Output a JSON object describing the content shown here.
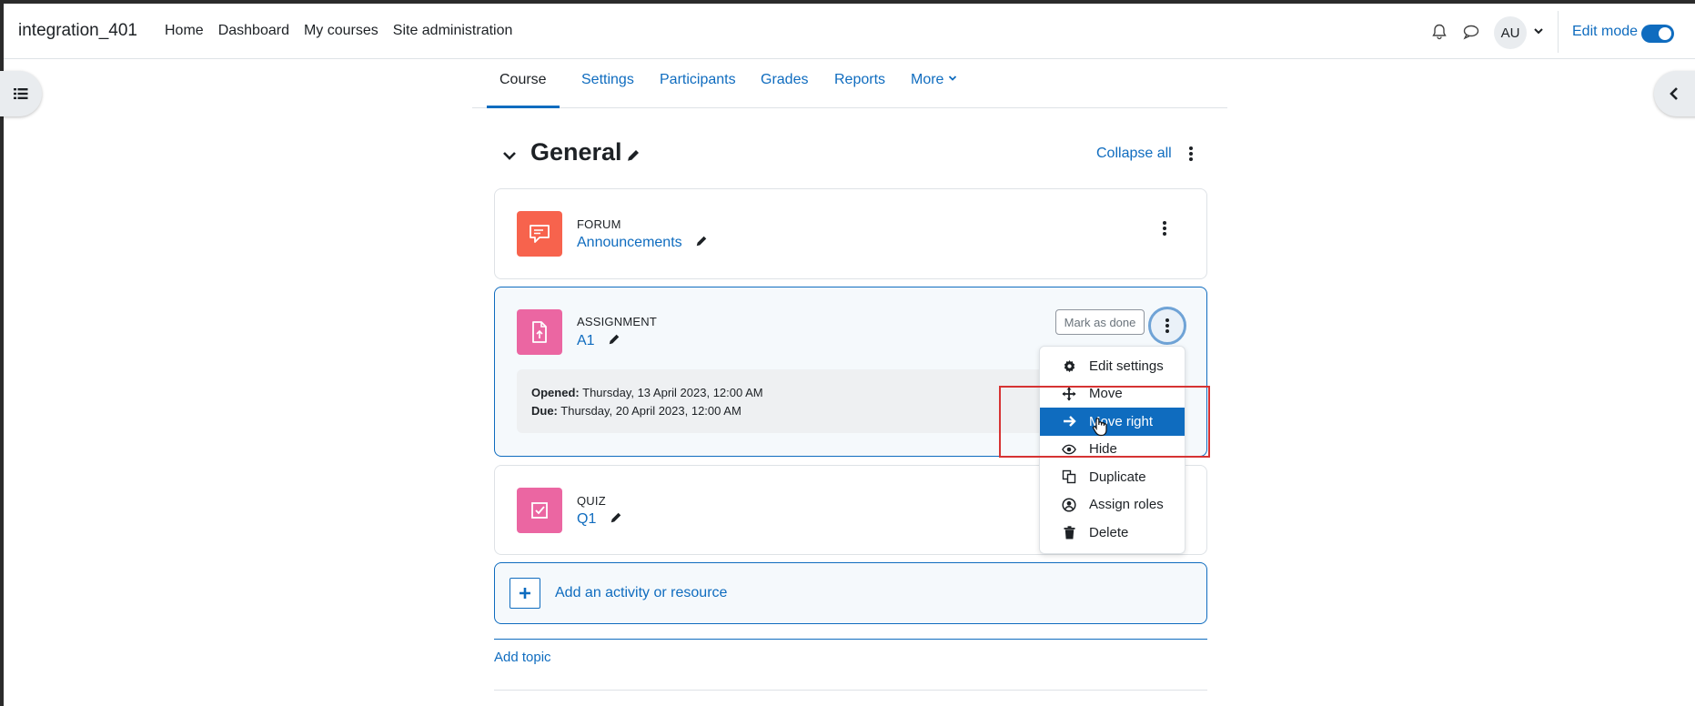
{
  "navbar": {
    "site_name": "integration_401",
    "links": [
      "Home",
      "Dashboard",
      "My courses",
      "Site administration"
    ],
    "avatar_initials": "AU",
    "edit_mode_label": "Edit mode",
    "edit_mode_on": true
  },
  "secondary_nav": {
    "tabs": [
      "Course",
      "Settings",
      "Participants",
      "Grades",
      "Reports",
      "More"
    ],
    "active": "Course"
  },
  "section": {
    "title": "General",
    "collapse_all": "Collapse all"
  },
  "activities": [
    {
      "type": "FORUM",
      "name": "Announcements",
      "icon": "forum-icon",
      "color": "#f7634d"
    },
    {
      "type": "ASSIGNMENT",
      "name": "A1",
      "icon": "assignment-icon",
      "color": "#eb66a2",
      "mark_done": "Mark as done",
      "opened_label": "Opened:",
      "opened_value": "Thursday, 13 April 2023, 12:00 AM",
      "due_label": "Due:",
      "due_value": "Thursday, 20 April 2023, 12:00 AM"
    },
    {
      "type": "QUIZ",
      "name": "Q1",
      "icon": "quiz-icon",
      "color": "#eb66a2"
    }
  ],
  "dropdown": {
    "items": [
      {
        "label": "Edit settings",
        "icon": "gear-icon"
      },
      {
        "label": "Move",
        "icon": "move-icon"
      },
      {
        "label": "Move right",
        "icon": "arrow-right-icon",
        "active": true
      },
      {
        "label": "Hide",
        "icon": "eye-icon"
      },
      {
        "label": "Duplicate",
        "icon": "duplicate-icon"
      },
      {
        "label": "Assign roles",
        "icon": "user-circle-icon"
      },
      {
        "label": "Delete",
        "icon": "trash-icon"
      }
    ]
  },
  "add_activity_label": "Add an activity or resource",
  "add_topic_label": "Add topic",
  "colors": {
    "accent": "#0f6cbf",
    "highlight_box": "#d63333"
  }
}
